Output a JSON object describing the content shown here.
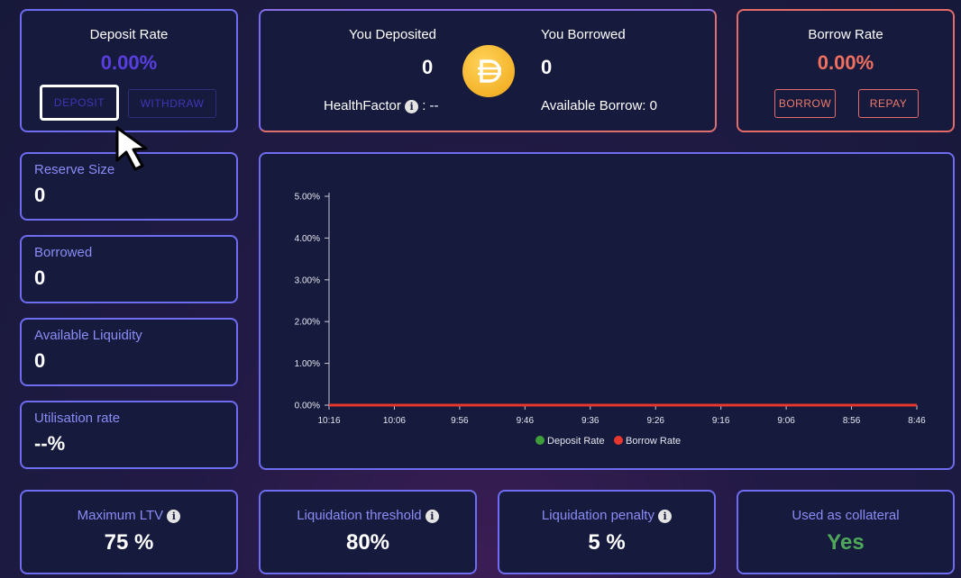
{
  "deposit": {
    "title": "Deposit Rate",
    "rate": "0.00%",
    "deposit_label": "DEPOSIT",
    "withdraw_label": "WITHDRAW"
  },
  "summary": {
    "deposited_label": "You Deposited",
    "deposited_value": "0",
    "borrowed_label": "You Borrowed",
    "borrowed_value": "0",
    "health_label": "HealthFactor",
    "health_value": ": --",
    "available_borrow": "Available Borrow: 0"
  },
  "borrow": {
    "title": "Borrow Rate",
    "rate": "0.00%",
    "borrow_label": "BORROW",
    "repay_label": "REPAY"
  },
  "stats": [
    {
      "label": "Reserve Size",
      "value": "0"
    },
    {
      "label": "Borrowed",
      "value": "0"
    },
    {
      "label": "Available Liquidity",
      "value": "0"
    },
    {
      "label": "Utilisation rate",
      "value": "--%"
    }
  ],
  "bottom": [
    {
      "label": "Maximum LTV",
      "value": "75 %"
    },
    {
      "label": "Liquidation threshold",
      "value": "80%"
    },
    {
      "label": "Liquidation penalty",
      "value": "5 %"
    },
    {
      "label": "Used as collateral",
      "value": "Yes"
    }
  ],
  "icons": {
    "coin": "dai-coin-icon",
    "info": "info-icon",
    "cursor": "pointer-cursor-icon"
  },
  "colors": {
    "deposit_series": "#3f9d3a",
    "borrow_series": "#e8372c",
    "accent": "#6e6cf0",
    "borrow_accent": "#e56a6a"
  },
  "chart_data": {
    "type": "line",
    "x": [
      "10:16",
      "10:06",
      "9:56",
      "9:46",
      "9:36",
      "9:26",
      "9:16",
      "9:06",
      "8:56",
      "8:46"
    ],
    "series": [
      {
        "name": "Deposit Rate",
        "values": [
          0,
          0,
          0,
          0,
          0,
          0,
          0,
          0,
          0,
          0
        ]
      },
      {
        "name": "Borrow Rate",
        "values": [
          0,
          0,
          0,
          0,
          0,
          0,
          0,
          0,
          0,
          0
        ]
      }
    ],
    "yticks": [
      "0.00%",
      "1.00%",
      "2.00%",
      "3.00%",
      "4.00%",
      "5.00%"
    ],
    "ylim": [
      0,
      5
    ],
    "legend": "bottom",
    "grid": false
  }
}
